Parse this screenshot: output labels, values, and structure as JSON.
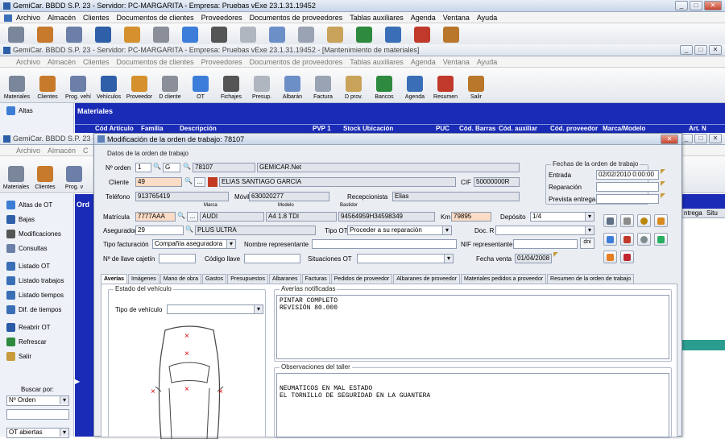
{
  "outer": {
    "title": "GemiCar. BBDD S.P. 23 - Servidor: PC-MARGARITA - Empresa: Pruebas vExe 23.1.31.19452",
    "menu": [
      "Archivo",
      "Almacén",
      "Clientes",
      "Documentos de clientes",
      "Proveedores",
      "Documentos de proveedores",
      "Tablas auxiliares",
      "Agenda",
      "Ventana",
      "Ayuda"
    ]
  },
  "mid": {
    "title": "GemiCar. BBDD S.P. 23 - Servidor: PC-MARGARITA - Empresa: Pruebas vExe 23.1.31.19452 - [Mantenimiento de materiales]",
    "menu": [
      "Archivo",
      "Almacén",
      "Clientes",
      "Documentos de clientes",
      "Proveedores",
      "Documentos de proveedores",
      "Tablas auxiliares",
      "Agenda",
      "Ventana",
      "Ayuda"
    ],
    "toolbar": [
      "Materiales",
      "Clientes",
      "Prog. vehí",
      "Vehículos",
      "Proveedor",
      "D cliente",
      "OT",
      "Fichajes",
      "Presup.",
      "Albarán",
      "Factura",
      "D prov.",
      "Bancos",
      "Agenda",
      "Resumen",
      "Salir"
    ],
    "sidebar_top": "Altas",
    "materiales_title": "Materiales",
    "columns": [
      "Cód Artículo",
      "Familia",
      "Descripción",
      "PVP 1",
      "Stock",
      "Ubicación",
      "PUC",
      "Cód. Barras",
      "Cód. auxiliar",
      "Cód. proveedor",
      "Marca/Modelo",
      "Art. N"
    ]
  },
  "back": {
    "title": "GemiCar. BBDD S.P. 23 - S",
    "menu": [
      "Archivo",
      "Almacén",
      "C"
    ],
    "toolbar": [
      "Materiales",
      "Clientes",
      "Prog. v"
    ],
    "sidebar": [
      "Altas de OT",
      "Bajas",
      "Modificaciones",
      "Consultas",
      "Listado OT",
      "Listado trabajos",
      "Listado tiempos",
      "Dif. de tiempos",
      "Reabrir OT",
      "Refrescar",
      "Salir"
    ],
    "grid_label": "Ord",
    "right_cols": [
      "ntrega",
      "Situ"
    ],
    "search_label": "Buscar por:",
    "search_value": "Nº Orden",
    "bottom_value": "OT abiertas"
  },
  "dialog": {
    "title": "Modificación de la orden de trabajo: 78107",
    "datos_label": "Datos de la orden de trabajo",
    "fechas_label": "Fechas de la orden de trabajo",
    "labels": {
      "num_orden": "Nº orden",
      "cliente": "Cliente",
      "telefono": "Teléfono",
      "movil": "Móvil",
      "recepcionista": "Recepcionista",
      "cif": "CIF",
      "marca": "Marca",
      "modelo": "Modelo",
      "bastidor": "Bastidor",
      "matricula": "Matrícula",
      "km": "Km",
      "deposito": "Depósito",
      "aseguradora": "Aseguradora",
      "tipo_ot": "Tipo OT",
      "doc_r": "Doc. R",
      "tipo_facturacion": "Tipo facturación",
      "nombre_representante": "Nombre representante",
      "nif_representante": "NIF representante",
      "llave_cajetin": "Nº de llave cajetín",
      "codigo_llave": "Código llave",
      "situaciones_ot": "Situaciones OT",
      "fecha_venta": "Fecha venta",
      "entrada": "Entrada",
      "reparacion": "Reparación",
      "prevista": "Prevista entrega"
    },
    "values": {
      "num_orden": "1",
      "serie": "G",
      "orden": "78107",
      "empresa": "GEMICAR.Net",
      "cliente_cod": "49",
      "cliente_nombre": "ELIAS SANTIAGO GARCIA",
      "cif": "50000000R",
      "telefono": "913765419",
      "movil": "630020277",
      "recepcionista": "Elias",
      "matricula": "7777AAA",
      "marca": "AUDI",
      "modelo": "A4 1.8 TDI",
      "bastidor": "94564959H34598349",
      "km": "79895",
      "deposito": "1/4",
      "aseg_cod": "29",
      "aseg_nombre": "PLUS ULTRA",
      "tipo_ot": "Proceder a su reparación",
      "tipo_facturacion": "Compañía aseguradora",
      "entrada": "02/02/2010 0:00:00",
      "fecha_venta": "01/04/2008"
    },
    "tabs": [
      "Averías",
      "Imágenes",
      "Mano de obra",
      "Gastos",
      "Presupuestos",
      "Albaranes",
      "Facturas",
      "Pedidos de proveedor",
      "Albaranes de proveedor",
      "Materiales pedidos a proveedor",
      "Resumen de la orden de trabajo"
    ],
    "estado_label": "Estado del vehículo",
    "tipo_vehiculo_label": "Tipo de vehículo",
    "averias_label": "Averías notificadas",
    "averias_text": "PINTAR COMPLETO\nREVISIÓN 80.000",
    "obs_label": "Observaciones del taller",
    "obs_text": "NEUMATICOS EN MAL ESTADO\nEL TORNILLO DE SEGURIDAD EN LA GUANTERA",
    "damage_mark": "×"
  }
}
